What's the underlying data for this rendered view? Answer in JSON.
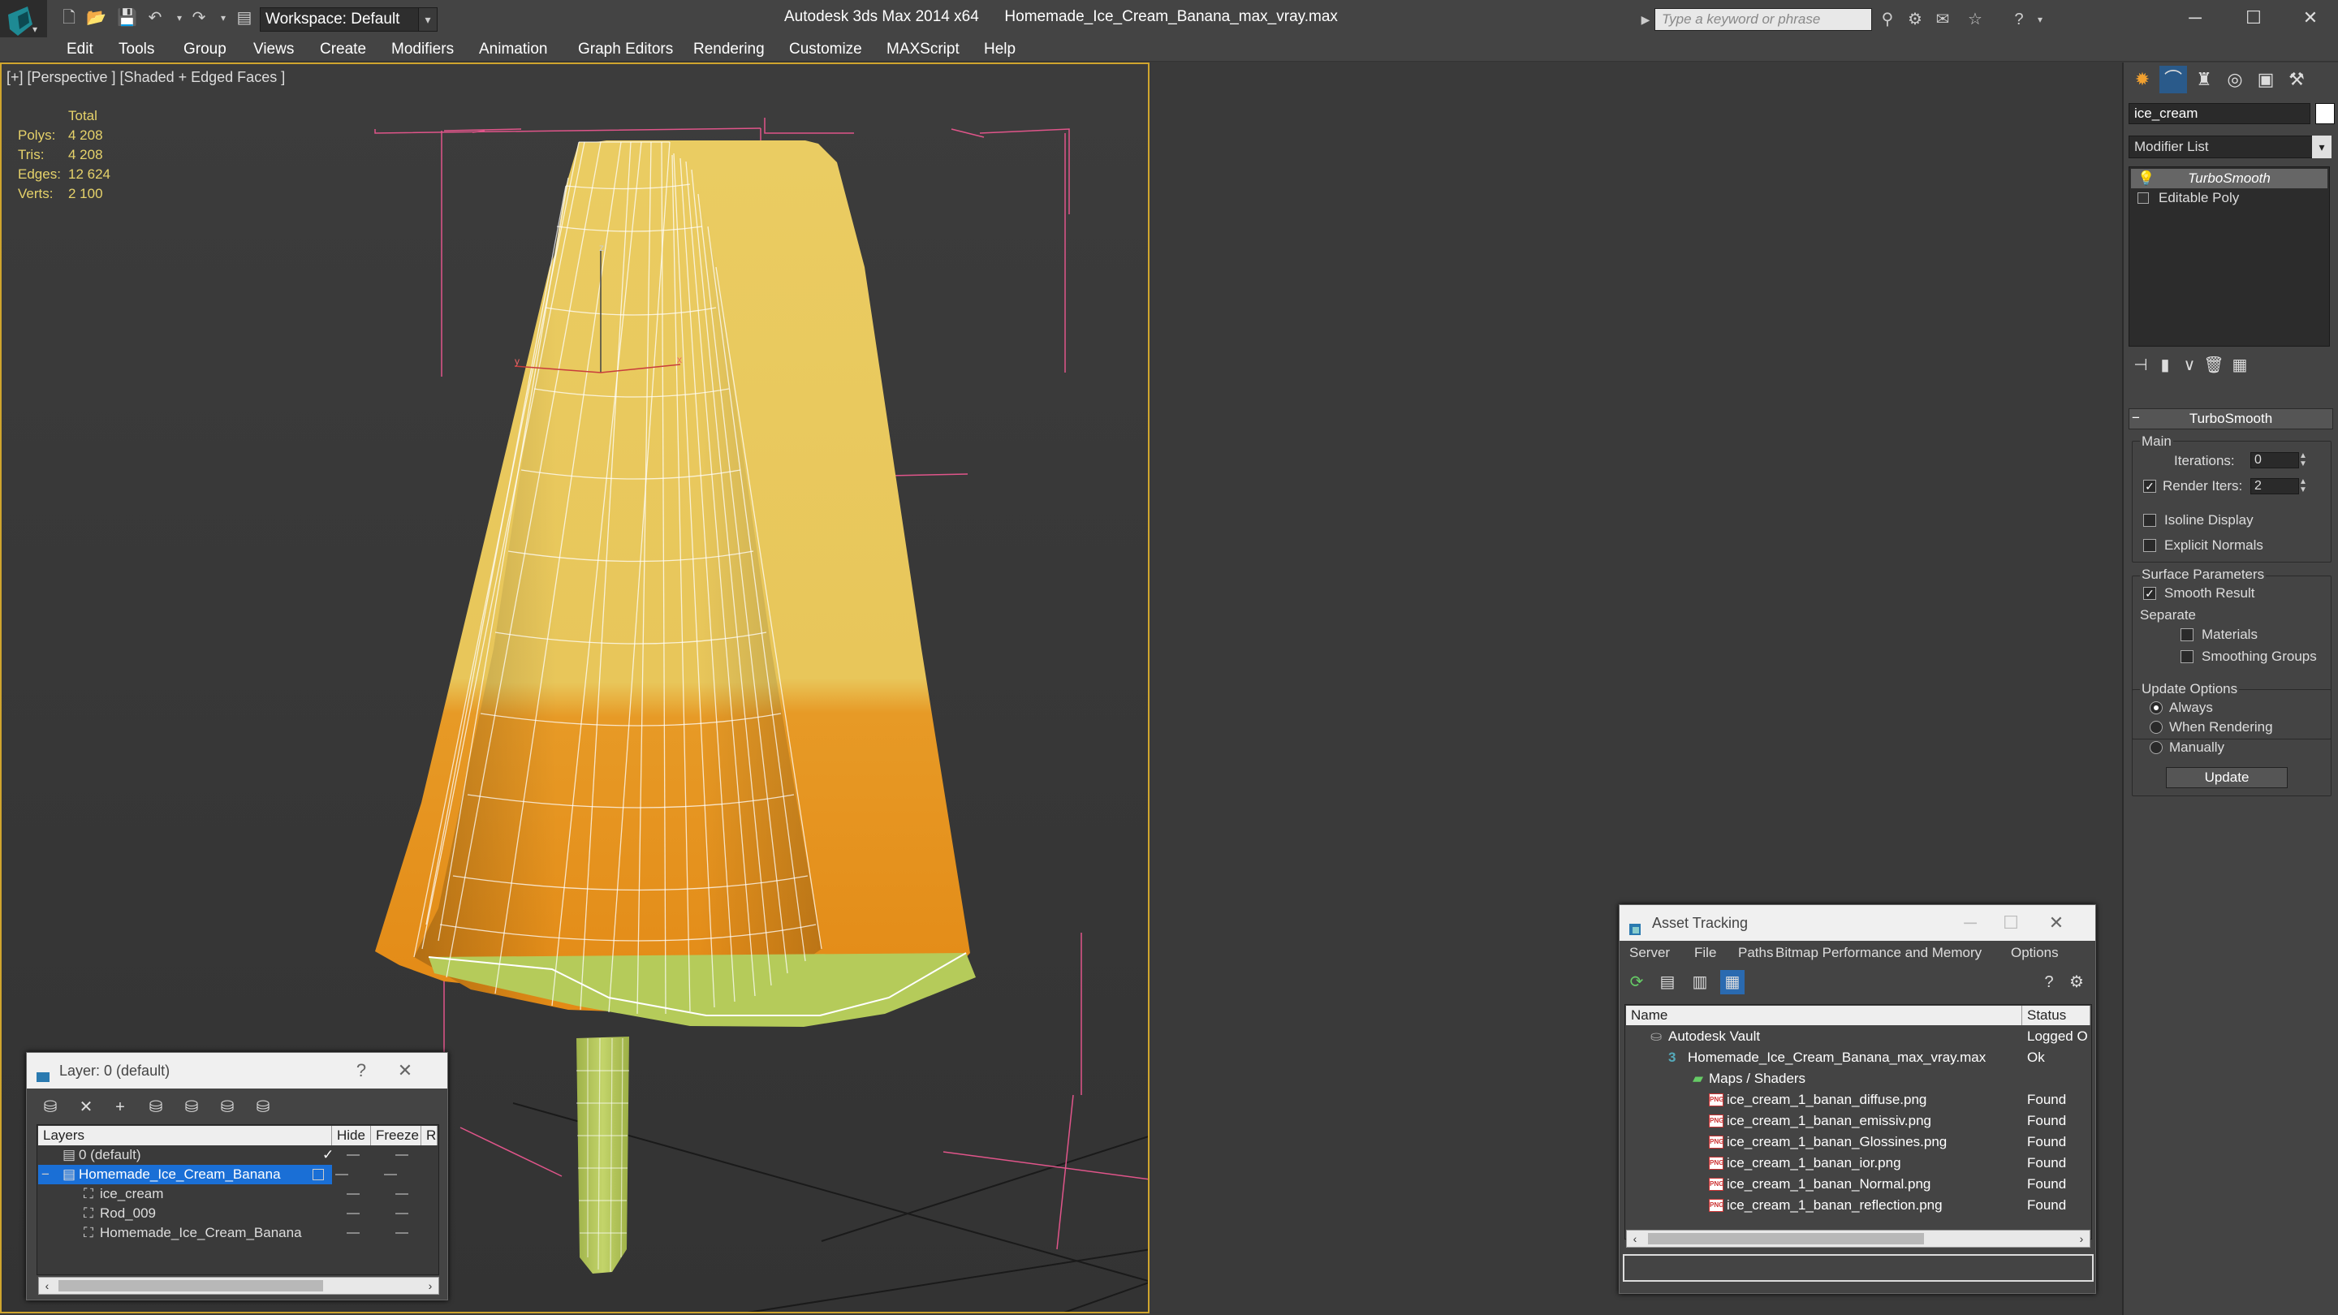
{
  "window": {
    "title": "Autodesk 3ds Max 2014 x64      Homemade_Ice_Cream_Banana_max_vray.max",
    "workspace": "Workspace: Default",
    "search_placeholder": "Type a keyword or phrase"
  },
  "menu": [
    "Edit",
    "Tools",
    "Group",
    "Views",
    "Create",
    "Modifiers",
    "Animation",
    "Graph Editors",
    "Rendering",
    "Customize",
    "MAXScript",
    "Help"
  ],
  "viewport": {
    "label": "[+] [Perspective ] [Shaded + Edged Faces ]",
    "stats": {
      "header": "Total",
      "polys_label": "Polys:",
      "polys": "4 208",
      "tris_label": "Tris:",
      "tris": "4 208",
      "edges_label": "Edges:",
      "edges": "12 624",
      "verts_label": "Verts:",
      "verts": "2 100"
    },
    "axis_z": "z",
    "axis_y": "y",
    "axis_x": "x"
  },
  "command_panel": {
    "object_name": "ice_cream",
    "object_color": "#ffffff",
    "modifier_list": "Modifier List",
    "stack": [
      "TurboSmooth",
      "Editable Poly"
    ],
    "rollout_title": "TurboSmooth",
    "main_label": "Main",
    "iterations_label": "Iterations:",
    "iterations": "0",
    "render_iters_label": "Render Iters:",
    "render_iters": "2",
    "isoline_label": "Isoline Display",
    "explicit_normals_label": "Explicit Normals",
    "surface_params_label": "Surface Parameters",
    "smooth_result_label": "Smooth Result",
    "separate_label": "Separate",
    "materials_label": "Materials",
    "smoothing_groups_label": "Smoothing Groups",
    "update_options_label": "Update Options",
    "always_label": "Always",
    "when_rendering_label": "When Rendering",
    "manually_label": "Manually",
    "update_button": "Update"
  },
  "layer_dialog": {
    "title": "Layer: 0 (default)",
    "help": "?",
    "columns": {
      "layers": "Layers",
      "hide": "Hide",
      "freeze": "Freeze",
      "render": "R"
    },
    "rows": [
      "0 (default)",
      "Homemade_Ice_Cream_Banana",
      "ice_cream",
      "Rod_009",
      "Homemade_Ice_Cream_Banana"
    ]
  },
  "asset_dialog": {
    "title": "Asset Tracking",
    "menu": [
      "Server",
      "File",
      "Paths",
      "Bitmap Performance and Memory",
      "Options"
    ],
    "columns": {
      "name": "Name",
      "status": "Status"
    },
    "rows": [
      {
        "name": "Autodesk Vault",
        "status": "Logged O"
      },
      {
        "name": "Homemade_Ice_Cream_Banana_max_vray.max",
        "status": "Ok"
      },
      {
        "name": "Maps / Shaders",
        "status": ""
      },
      {
        "name": "ice_cream_1_banan_diffuse.png",
        "status": "Found"
      },
      {
        "name": "ice_cream_1_banan_emissiv.png",
        "status": "Found"
      },
      {
        "name": "ice_cream_1_banan_Glossines.png",
        "status": "Found"
      },
      {
        "name": "ice_cream_1_banan_ior.png",
        "status": "Found"
      },
      {
        "name": "ice_cream_1_banan_Normal.png",
        "status": "Found"
      },
      {
        "name": "ice_cream_1_banan_reflection.png",
        "status": "Found"
      }
    ]
  },
  "colors": {
    "viewport_border": "#cfa52e",
    "selection": "#1a6fd6",
    "stats_text": "#e6d26a",
    "ice_cream_yellow": "#e8c95a",
    "ice_cream_orange": "#e8921f",
    "stick_green": "#b7cc5e"
  }
}
